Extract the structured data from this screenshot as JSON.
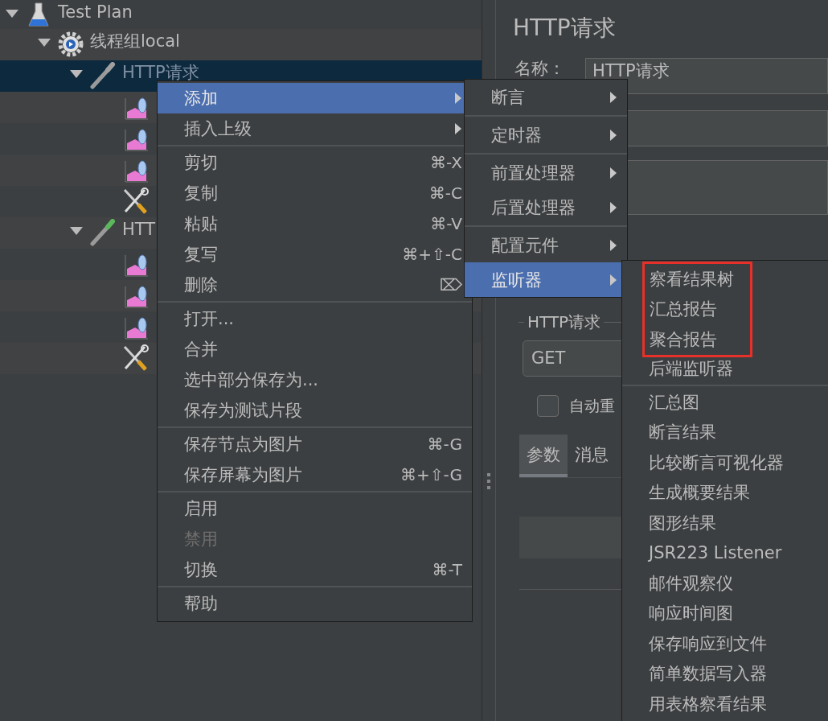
{
  "tree": [
    {
      "label": "Test Plan",
      "kind": "plan",
      "expanded": true,
      "selected": false,
      "children": [
        {
          "label": "线程组local",
          "kind": "thread-group",
          "expanded": true,
          "selected": false,
          "children": [
            {
              "label": "HTTP请求",
              "kind": "sampler",
              "expanded": true,
              "selected": true,
              "children": [
                {
                  "kind": "listener",
                  "selected": false
                },
                {
                  "kind": "listener",
                  "selected": false
                },
                {
                  "kind": "listener",
                  "selected": false
                },
                {
                  "kind": "config",
                  "selected": false
                }
              ]
            },
            {
              "label": "HTT",
              "kind": "sampler",
              "expanded": true,
              "selected": false,
              "children": [
                {
                  "kind": "listener",
                  "selected": false
                },
                {
                  "kind": "listener",
                  "selected": false
                },
                {
                  "kind": "listener",
                  "selected": false
                },
                {
                  "kind": "config",
                  "selected": false
                }
              ]
            }
          ]
        }
      ]
    }
  ],
  "panel": {
    "title": "HTTP请求",
    "name_label": "名称：",
    "name_value": "HTTP请求",
    "group_label": "HTTP请求",
    "method": "GET",
    "checkbox": {
      "label": "自动重",
      "checked": false
    },
    "tabs": [
      {
        "label": "参数",
        "selected": true
      },
      {
        "label": "消息",
        "selected": false
      }
    ]
  },
  "context_menu": {
    "groups": [
      [
        {
          "label": "添加",
          "submenu": true,
          "selected": true,
          "disabled": false
        },
        {
          "label": "插入上级",
          "submenu": true,
          "selected": false,
          "disabled": false
        }
      ],
      [
        {
          "label": "剪切",
          "shortcut": "⌘-X",
          "selected": false,
          "disabled": false
        },
        {
          "label": "复制",
          "shortcut": "⌘-C",
          "selected": false,
          "disabled": false
        },
        {
          "label": "粘贴",
          "shortcut": "⌘-V",
          "selected": false,
          "disabled": false
        },
        {
          "label": "复写",
          "shortcut": "⌘+⇧-C",
          "selected": false,
          "disabled": false
        },
        {
          "label": "删除",
          "shortcut": "⌦",
          "selected": false,
          "disabled": false
        }
      ],
      [
        {
          "label": "打开...",
          "selected": false,
          "disabled": false
        },
        {
          "label": "合并",
          "selected": false,
          "disabled": false
        },
        {
          "label": "选中部分保存为...",
          "selected": false,
          "disabled": false
        },
        {
          "label": "保存为测试片段",
          "selected": false,
          "disabled": false
        }
      ],
      [
        {
          "label": "保存节点为图片",
          "shortcut": "⌘-G",
          "selected": false,
          "disabled": false
        },
        {
          "label": "保存屏幕为图片",
          "shortcut": "⌘+⇧-G",
          "selected": false,
          "disabled": false
        }
      ],
      [
        {
          "label": "启用",
          "selected": false,
          "disabled": false
        },
        {
          "label": "禁用",
          "selected": false,
          "disabled": true
        },
        {
          "label": "切换",
          "shortcut": "⌘-T",
          "selected": false,
          "disabled": false
        }
      ],
      [
        {
          "label": "帮助",
          "selected": false,
          "disabled": false
        }
      ]
    ]
  },
  "add_menu": {
    "groups": [
      [
        {
          "label": "断言",
          "submenu": true,
          "selected": false
        }
      ],
      [
        {
          "label": "定时器",
          "submenu": true,
          "selected": false
        }
      ],
      [
        {
          "label": "前置处理器",
          "submenu": true,
          "selected": false
        },
        {
          "label": "后置处理器",
          "submenu": true,
          "selected": false
        }
      ],
      [
        {
          "label": "配置元件",
          "submenu": true,
          "selected": false
        },
        {
          "label": "监听器",
          "submenu": true,
          "selected": true
        }
      ]
    ]
  },
  "listener_menu": {
    "groups": [
      [
        {
          "label": "察看结果树",
          "marked": true,
          "selected": false
        },
        {
          "label": "汇总报告",
          "marked": true,
          "selected": false
        },
        {
          "label": "聚合报告",
          "marked": true,
          "selected": false
        },
        {
          "label": "后端监听器",
          "marked": false,
          "selected": false
        }
      ],
      [
        {
          "label": "汇总图",
          "marked": false,
          "selected": false
        },
        {
          "label": "断言结果",
          "marked": false,
          "selected": false
        },
        {
          "label": "比较断言可视化器",
          "marked": false,
          "selected": false
        },
        {
          "label": "生成概要结果",
          "marked": false,
          "selected": false
        },
        {
          "label": "图形结果",
          "marked": false,
          "selected": false
        },
        {
          "label": "JSR223 Listener",
          "marked": false,
          "selected": false
        },
        {
          "label": "邮件观察仪",
          "marked": false,
          "selected": false
        },
        {
          "label": "响应时间图",
          "marked": false,
          "selected": false
        },
        {
          "label": "保存响应到文件",
          "marked": false,
          "selected": false
        },
        {
          "label": "简单数据写入器",
          "marked": false,
          "selected": false
        },
        {
          "label": "用表格察看结果",
          "marked": false,
          "selected": false
        }
      ]
    ]
  }
}
